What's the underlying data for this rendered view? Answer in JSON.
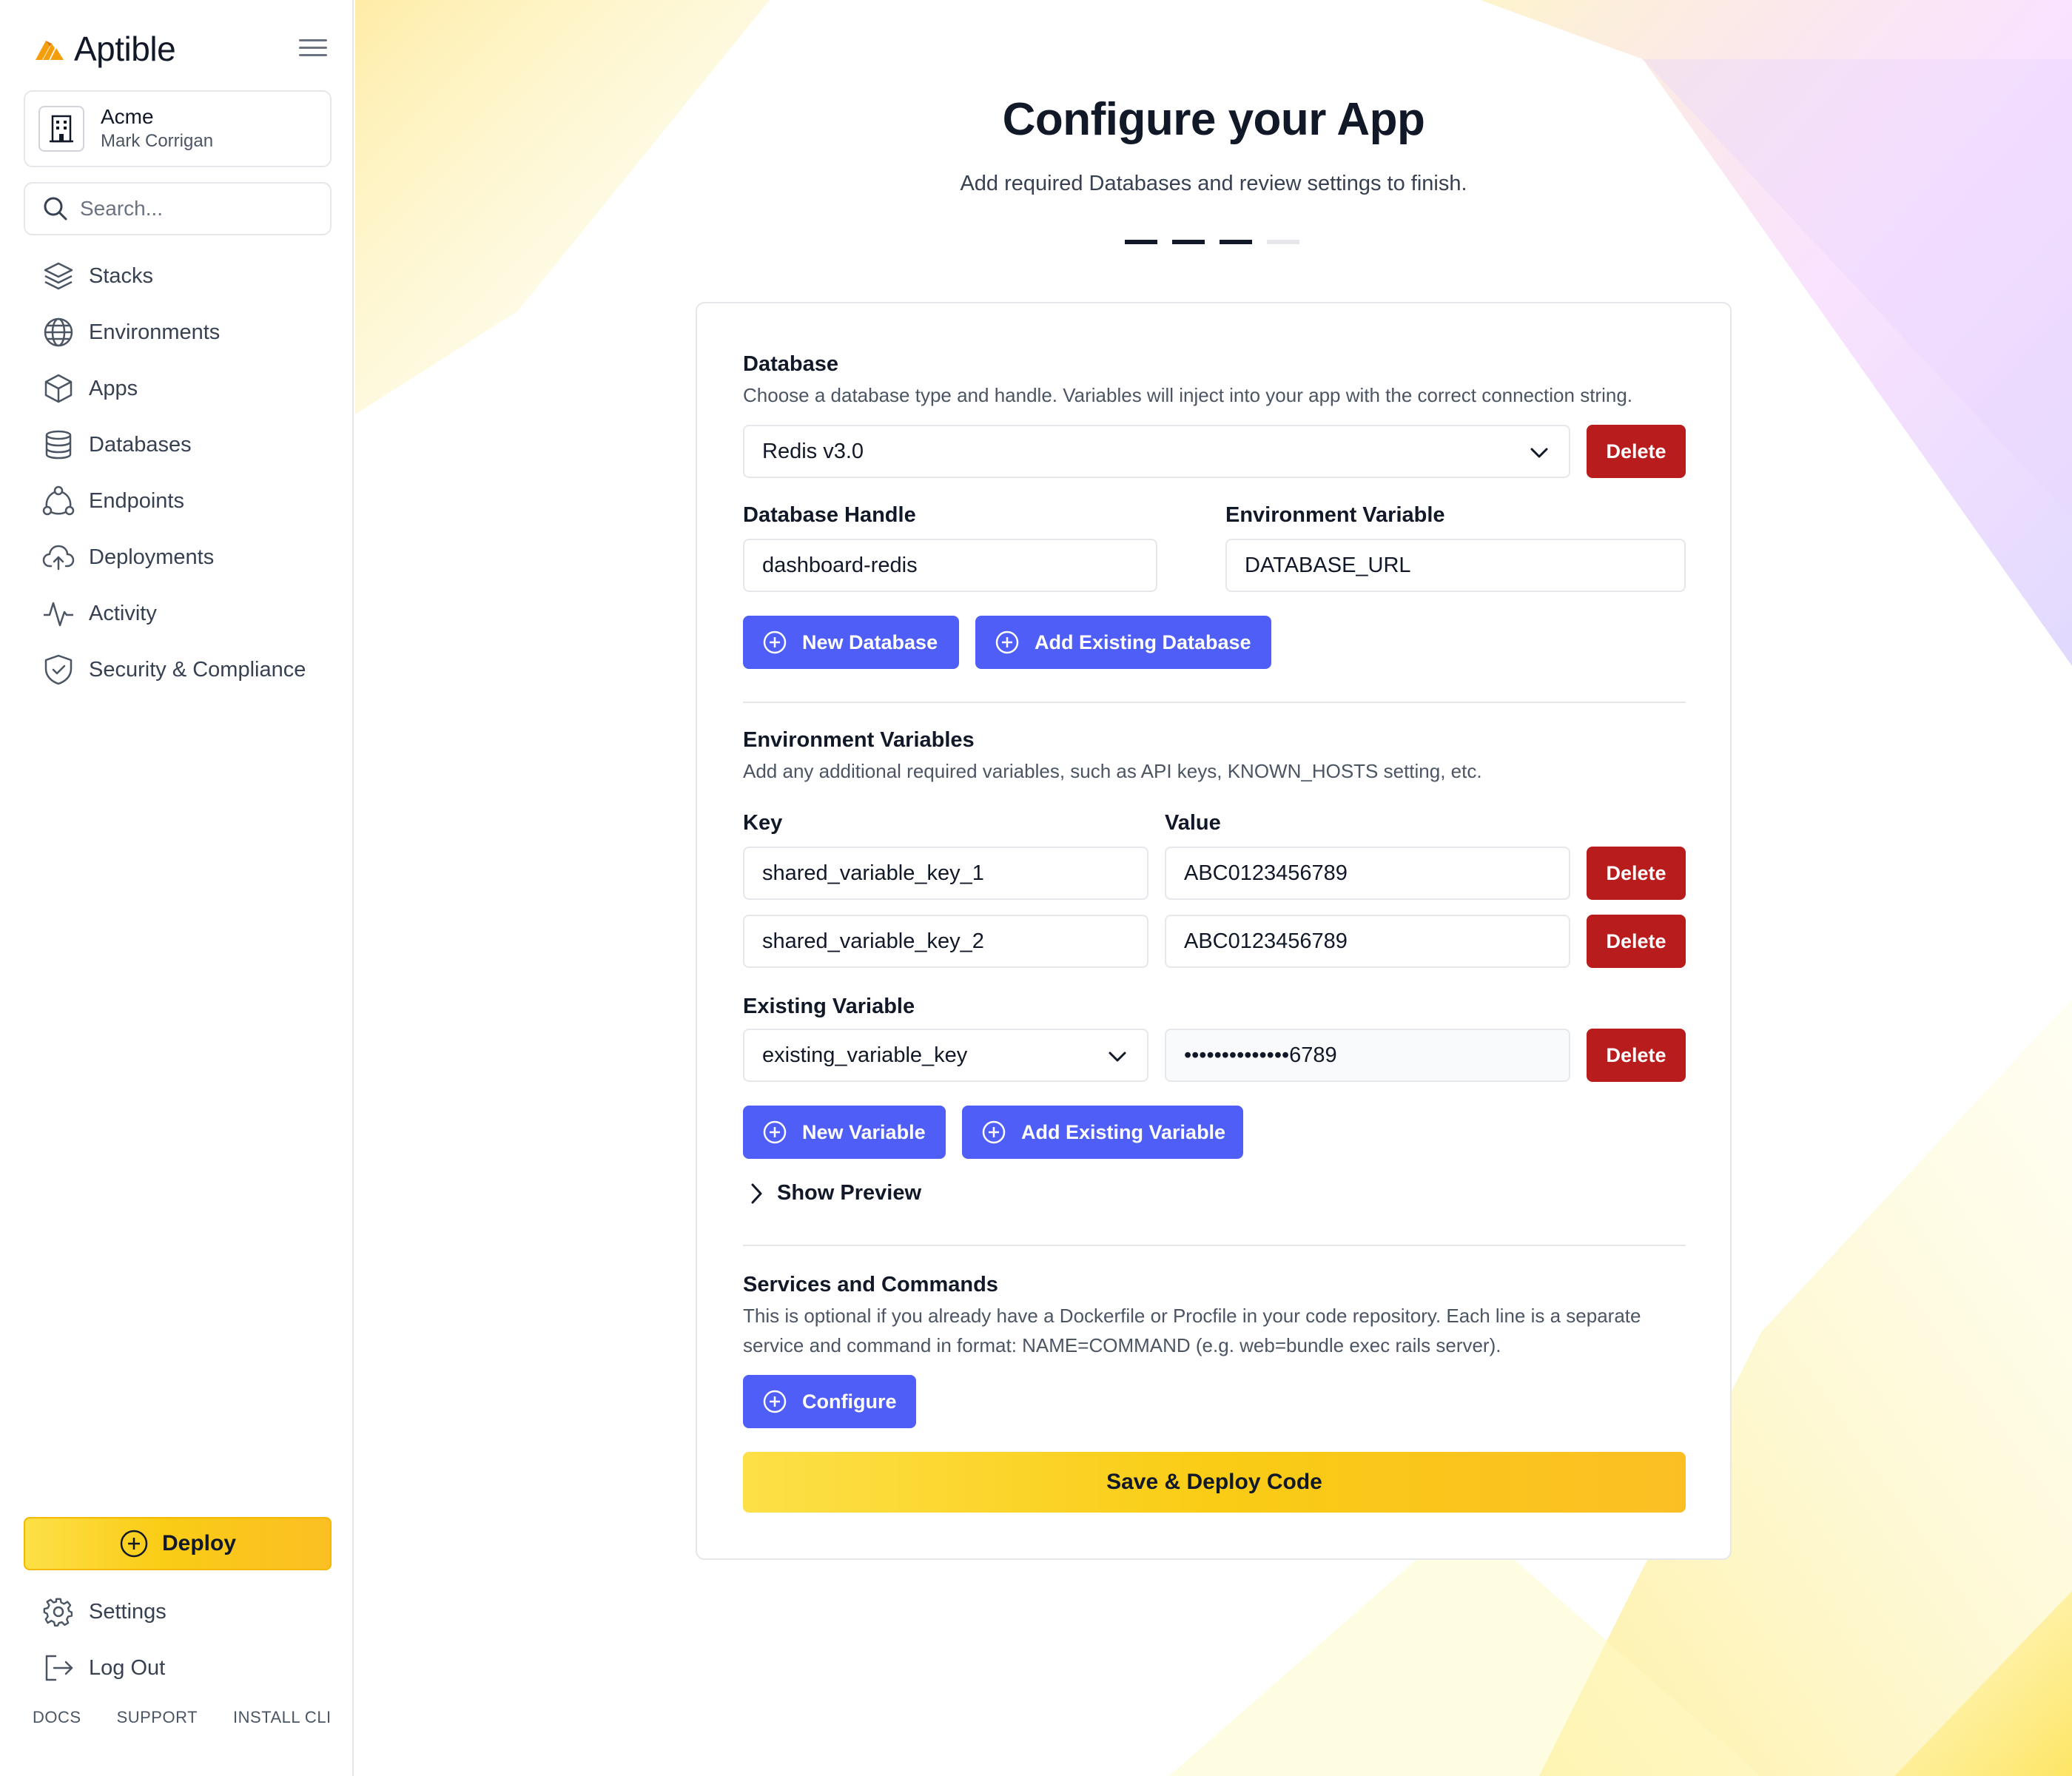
{
  "brand": {
    "name": "Aptible",
    "accent": "#f59e0b"
  },
  "org": {
    "name": "Acme",
    "user": "Mark Corrigan"
  },
  "search": {
    "placeholder": "Search..."
  },
  "sidebar": {
    "items": [
      {
        "label": "Stacks",
        "icon": "layers-icon"
      },
      {
        "label": "Environments",
        "icon": "globe-icon"
      },
      {
        "label": "Apps",
        "icon": "cube-icon"
      },
      {
        "label": "Databases",
        "icon": "database-icon"
      },
      {
        "label": "Endpoints",
        "icon": "endpoints-icon"
      },
      {
        "label": "Deployments",
        "icon": "cloud-upload-icon"
      },
      {
        "label": "Activity",
        "icon": "activity-icon"
      },
      {
        "label": "Security & Compliance",
        "icon": "shield-icon"
      }
    ],
    "deploy_label": "Deploy",
    "bottom_items": [
      {
        "label": "Settings",
        "icon": "gear-icon"
      },
      {
        "label": "Log Out",
        "icon": "logout-icon"
      }
    ],
    "footer_links": [
      "DOCS",
      "SUPPORT",
      "INSTALL CLI"
    ]
  },
  "page": {
    "title": "Configure your App",
    "subtitle": "Add required Databases and review settings to finish.",
    "steps_total": 4,
    "steps_done": 3
  },
  "database": {
    "title": "Database",
    "description": "Choose a database type and handle. Variables will inject into your app with the correct connection string.",
    "type_value": "Redis v3.0",
    "delete_label": "Delete",
    "handle_label": "Database Handle",
    "handle_value": "dashboard-redis",
    "env_var_label": "Environment Variable",
    "env_var_value": "DATABASE_URL",
    "new_button": "New Database",
    "existing_button": "Add Existing Database"
  },
  "env_vars": {
    "title": "Environment Variables",
    "description": "Add any additional required variables, such as API keys, KNOWN_HOSTS setting, etc.",
    "key_label": "Key",
    "value_label": "Value",
    "rows": [
      {
        "key": "shared_variable_key_1",
        "value": "ABC0123456789"
      },
      {
        "key": "shared_variable_key_2",
        "value": "ABC0123456789"
      }
    ],
    "delete_label": "Delete",
    "existing_label": "Existing Variable",
    "existing_key": "existing_variable_key",
    "existing_value": "••••••••••••••6789",
    "new_button": "New Variable",
    "existing_button": "Add Existing Variable",
    "preview_label": "Show Preview"
  },
  "services": {
    "title": "Services and Commands",
    "description_1": "This is optional if you already have a Dockerfile or Procfile in your code repository. Each line is a separate",
    "description_2": "service and command in format: NAME=COMMAND (e.g. web=bundle exec rails server).",
    "configure_button": "Configure"
  },
  "save_button": "Save & Deploy Code",
  "colors": {
    "primary_blue": "#4f5ef7",
    "danger_red": "#b91c1c",
    "yellow": "#facc15"
  }
}
